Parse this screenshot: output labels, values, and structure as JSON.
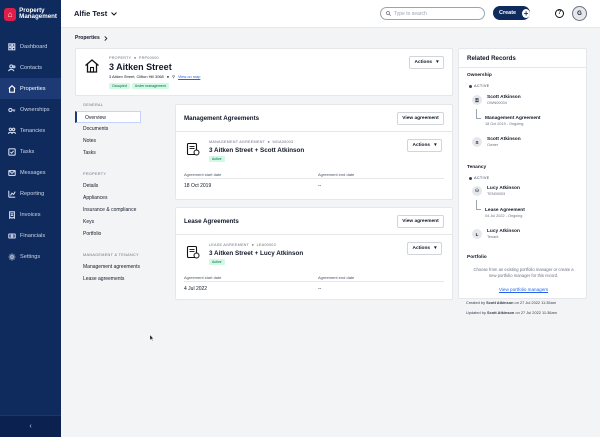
{
  "app": {
    "logo_line1": "Property",
    "logo_line2": "Management",
    "account_name": "Alfie Test",
    "search_placeholder": "Type to search",
    "create_label": "Create",
    "avatar_initial": "G"
  },
  "sidebar": {
    "items": [
      {
        "label": "Dashboard",
        "icon": "dashboard-icon"
      },
      {
        "label": "Contacts",
        "icon": "contacts-icon"
      },
      {
        "label": "Properties",
        "icon": "home-icon"
      },
      {
        "label": "Ownerships",
        "icon": "key-icon"
      },
      {
        "label": "Tenancies",
        "icon": "people-icon"
      },
      {
        "label": "Tasks",
        "icon": "tasks-icon"
      },
      {
        "label": "Messages",
        "icon": "mail-icon"
      },
      {
        "label": "Reporting",
        "icon": "chart-icon"
      },
      {
        "label": "Invoices",
        "icon": "invoice-icon"
      },
      {
        "label": "Financials",
        "icon": "money-icon"
      },
      {
        "label": "Settings",
        "icon": "gear-icon"
      }
    ],
    "active_index": 2
  },
  "breadcrumb": {
    "label": "Properties"
  },
  "property": {
    "type_label": "PROPERTY",
    "ref": "PRP00000",
    "title": "3 Aitken Street",
    "address": "3 Aitken Street, Clifton Hill 3068",
    "map_link": "View on map",
    "badges": [
      "Occupied",
      "Under management"
    ],
    "actions_label": "Actions"
  },
  "subnav": {
    "general_heading": "GENERAL",
    "general_items": [
      "Overview",
      "Documents",
      "Notes",
      "Tasks"
    ],
    "property_heading": "PROPERTY",
    "property_items": [
      "Details",
      "Appliances",
      "Insurance & compliance",
      "Keys",
      "Portfolio"
    ],
    "mgmt_heading": "MANAGEMENT & TENANCY",
    "mgmt_items": [
      "Management agreements",
      "Lease agreements"
    ]
  },
  "management": {
    "section_title": "Management Agreements",
    "view_label": "View agreement",
    "type_label": "MANAGEMENT AGREEMENT",
    "ref": "MGA00003",
    "name": "3 Aitken Street + Scott Atkinson",
    "status": "Active",
    "actions_label": "Actions",
    "start_label": "Agreement start date",
    "end_label": "Agreement end date",
    "start_value": "18 Oct 2019",
    "end_value": "--"
  },
  "lease": {
    "section_title": "Lease Agreements",
    "view_label": "View agreement",
    "type_label": "LEASE AGREEMENT",
    "ref": "LEA00003",
    "name": "3 Aitken Street + Lucy Atkinson",
    "status": "Active",
    "actions_label": "Actions",
    "start_label": "Agreement start date",
    "end_label": "Agreement end date",
    "start_value": "4 Jul 2022",
    "end_value": "--"
  },
  "related": {
    "title": "Related Records",
    "ownership_heading": "Ownership",
    "ownership_status": "ACTIVE",
    "ownership_owner_name": "Scott Atkinson",
    "ownership_owner_ref": "OWN00004",
    "ownership_agreement_name": "Management Agreement",
    "ownership_agreement_sub": "18 Oct 2019 - Ongoing",
    "ownership_contact_name": "Scott Atkinson",
    "ownership_contact_role": "Owner",
    "ownership_contact_initial": "S",
    "tenancy_heading": "Tenancy",
    "tenancy_status": "ACTIVE",
    "tenancy_tenant_name": "Lucy Atkinson",
    "tenancy_tenant_ref": "TEN00003",
    "tenancy_agreement_name": "Lease Agreement",
    "tenancy_agreement_sub": "04 Jul 2022 - Ongoing",
    "tenancy_contact_name": "Lucy Atkinson",
    "tenancy_contact_role": "Tenant",
    "tenancy_contact_initial": "L",
    "portfolio_heading": "Portfolio",
    "portfolio_empty": "Choose from an existing portfolio manager or create a new portfolio manager for this record.",
    "portfolio_link": "View portfolio managers"
  },
  "audit": {
    "created_prefix": "Created by",
    "created_by": "Scott Atkinson",
    "created_suffix": "on 27 Jul 2022 11:35am",
    "updated_prefix": "Updated by",
    "updated_by": "Scott Atkinson",
    "updated_suffix": "on 27 Jul 2022 11:36am"
  },
  "colors": {
    "sidebar": "#0f2a5c",
    "accent": "#2563eb",
    "active_badge": "#d1fae5"
  }
}
